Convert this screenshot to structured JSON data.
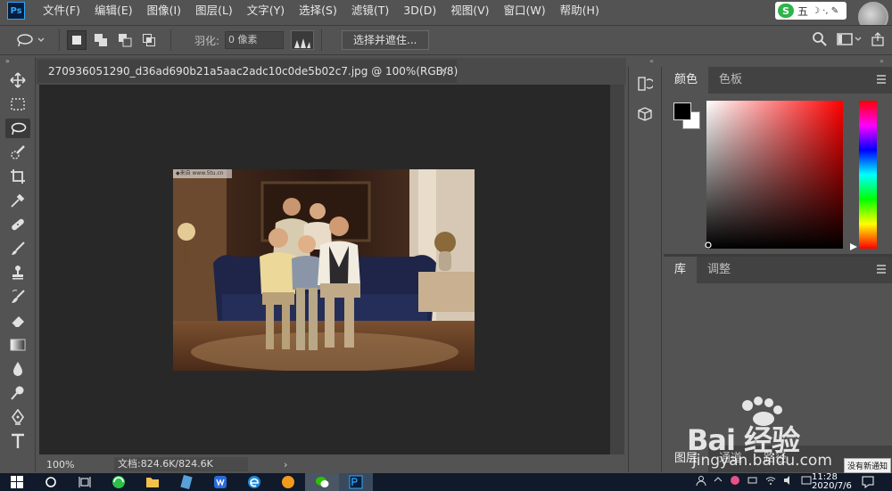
{
  "app": {
    "logo": "Ps"
  },
  "menu": [
    "文件(F)",
    "编辑(E)",
    "图像(I)",
    "图层(L)",
    "文字(Y)",
    "选择(S)",
    "滤镜(T)",
    "3D(D)",
    "视图(V)",
    "窗口(W)",
    "帮助(H)"
  ],
  "ime": {
    "logo": "S",
    "mode": "五",
    "marks": "☽ ·,  ✎"
  },
  "options": {
    "feather_label": "羽化:",
    "feather_value": "0 像素",
    "select_mask_label": "选择并遮住..."
  },
  "document": {
    "tab_title": "270936051290_d36ad690b21a5aac2adc10c0de5b02c7.jpg @ 100%(RGB/8)",
    "close_glyph": "×",
    "watermark": "◆来自 www.5tu.cn"
  },
  "status": {
    "zoom": "100%",
    "doc_info": "文档:824.6K/824.6K",
    "arrow": "›"
  },
  "panels": {
    "color_tabs": [
      "颜色",
      "色板"
    ],
    "lib_tabs": [
      "库",
      "调整"
    ],
    "layers_tabs": [
      "图层",
      "通道",
      "路径"
    ],
    "foreground_color": "#000000",
    "background_color": "#ffffff"
  },
  "tools": [
    "move-tool-icon",
    "marquee-tool-icon",
    "lasso-tool-icon",
    "quick-select-tool-icon",
    "crop-tool-icon",
    "eyedropper-tool-icon",
    "healing-brush-tool-icon",
    "brush-tool-icon",
    "clone-stamp-tool-icon",
    "history-brush-tool-icon",
    "eraser-tool-icon",
    "gradient-tool-icon",
    "blur-tool-icon",
    "dodge-tool-icon",
    "pen-tool-icon",
    "type-tool-icon"
  ],
  "taskbar": {
    "clock_time": "11:28",
    "clock_date": "2020/7/6",
    "notify_tip": "没有新通知"
  },
  "watermark": {
    "brand": "Bai 经验",
    "url": "jingyan.baidu.com"
  }
}
